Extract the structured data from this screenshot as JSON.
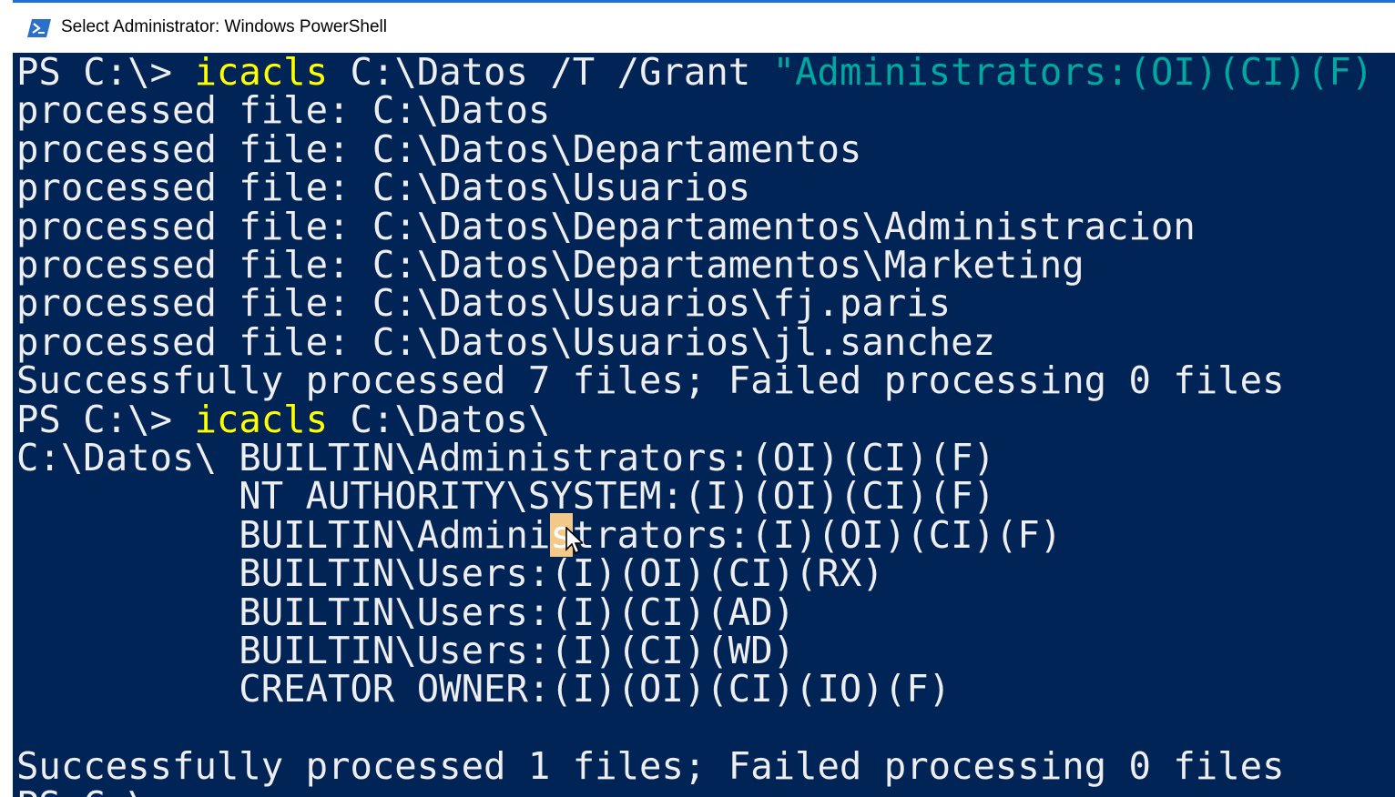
{
  "window": {
    "title": "Select Administrator: Windows PowerShell",
    "icon": "powershell-icon",
    "accent_color": "#1f6fd6"
  },
  "console": {
    "background_color": "#012456",
    "text_color": "#eeedf0",
    "command_color": "#ffff00",
    "string_color": "#00a8a0",
    "cmd1": {
      "prompt": "PS C:\\> ",
      "command": "icacls",
      "args": " C:\\Datos /T /Grant ",
      "string": "\"Administrators:(OI)(CI)(F)"
    },
    "output1": [
      "processed file: C:\\Datos",
      "processed file: C:\\Datos\\Departamentos",
      "processed file: C:\\Datos\\Usuarios",
      "processed file: C:\\Datos\\Departamentos\\Administracion",
      "processed file: C:\\Datos\\Departamentos\\Marketing",
      "processed file: C:\\Datos\\Usuarios\\fj.paris",
      "processed file: C:\\Datos\\Usuarios\\jl.sanchez",
      "Successfully processed 7 files; Failed processing 0 files"
    ],
    "cmd2": {
      "prompt": "PS C:\\> ",
      "command": "icacls",
      "args": " C:\\Datos\\"
    },
    "acl": {
      "first": "C:\\Datos\\ BUILTIN\\Administrators:(OI)(CI)(F)",
      "second": "          NT AUTHORITY\\SYSTEM:(I)(OI)(CI)(F)",
      "third_before": "          BUILTIN\\Admini",
      "third_selected": "s",
      "third_after": "trators:(I)(OI)(CI)(F)",
      "rest": [
        "          BUILTIN\\Users:(I)(OI)(CI)(RX)",
        "          BUILTIN\\Users:(I)(CI)(AD)",
        "          BUILTIN\\Users:(I)(CI)(WD)",
        "          CREATOR OWNER:(I)(OI)(CI)(IO)(F)"
      ]
    },
    "summary2": "Successfully processed 1 files; Failed processing 0 files",
    "next_prompt": "PS C:\\>",
    "cursor_icon": "mouse-pointer-icon"
  }
}
